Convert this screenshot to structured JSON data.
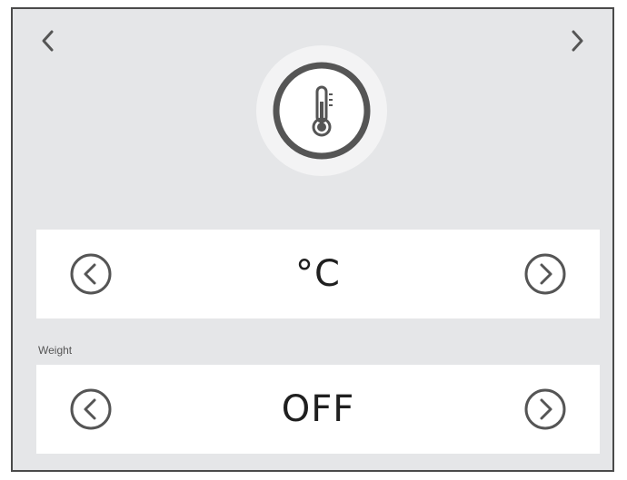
{
  "navigation": {
    "prev_icon": "chevron-left-icon",
    "next_icon": "chevron-right-icon"
  },
  "badge": {
    "icon": "thermometer-icon"
  },
  "unit_selector": {
    "value": "°C",
    "decrease_icon": "circle-chevron-left-icon",
    "increase_icon": "circle-chevron-right-icon"
  },
  "weight_selector": {
    "label": "Weight",
    "value": "OFF",
    "decrease_icon": "circle-chevron-left-icon",
    "increase_icon": "circle-chevron-right-icon"
  },
  "colors": {
    "panel_background": "#e5e6e8",
    "row_background": "#ffffff",
    "icon_stroke": "#555555",
    "text": "#1f1f1f"
  }
}
